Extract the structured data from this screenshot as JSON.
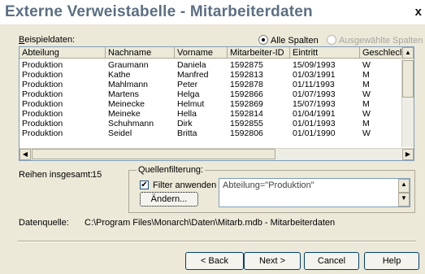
{
  "window": {
    "title": "Externe Verweistabelle - Mitarbeiterdaten",
    "close_glyph": "x"
  },
  "sample_label_prefix": "B",
  "sample_label_rest": "eispieldaten:",
  "radio_all": "Alle Spalten",
  "radio_selected": "Ausgewählte Spalten",
  "grid": {
    "columns": [
      "Abteilung",
      "Nachname",
      "Vorname",
      "Mitarbeiter-ID",
      "Eintritt",
      "Geschlech"
    ],
    "rows": [
      [
        "Produktion",
        "Graumann",
        "Daniela",
        "1592875",
        "15/09/1993",
        "W"
      ],
      [
        "Produktion",
        "Kathe",
        "Manfred",
        "1592813",
        "01/03/1991",
        "M"
      ],
      [
        "Produktion",
        "Mahlmann",
        "Peter",
        "1592878",
        "01/11/1993",
        "M"
      ],
      [
        "Produktion",
        "Martens",
        "Helga",
        "1592866",
        "01/07/1993",
        "W"
      ],
      [
        "Produktion",
        "Meinecke",
        "Helmut",
        "1592869",
        "15/07/1993",
        "M"
      ],
      [
        "Produktion",
        "Meineke",
        "Hella",
        "1592814",
        "01/04/1991",
        "W"
      ],
      [
        "Produktion",
        "Schuhmann",
        "Dirk",
        "1592855",
        "01/01/1993",
        "M"
      ],
      [
        "Produktion",
        "Seidel",
        "Britta",
        "1592806",
        "01/01/1990",
        "W"
      ]
    ]
  },
  "rows_total_label": "Reihen insgesamt:",
  "rows_total_value": "15",
  "filter_group_label": "Quellenfilterung:",
  "filter_apply_label": "Filter anwenden",
  "filter_expression": "Abteilung=\"Produktion\"",
  "change_button": "Ändern...",
  "source_label": "Datenquelle:",
  "source_value": "C:\\Program Files\\Monarch\\Daten\\Mitarb.mdb - Mitarbeiterdaten",
  "buttons": {
    "back": "< Back",
    "next": "Next >",
    "cancel": "Cancel",
    "help": "Help"
  }
}
